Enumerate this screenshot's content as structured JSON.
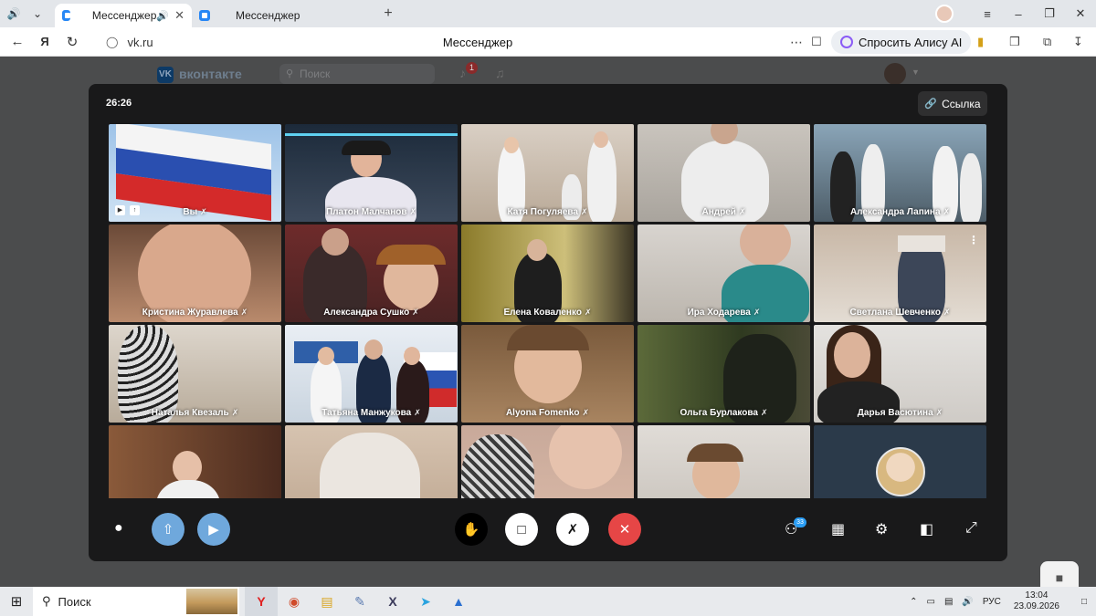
{
  "browser": {
    "tabs": [
      {
        "label": "Мессенджер",
        "active": true
      },
      {
        "label": "Мессенджер",
        "active": false
      }
    ],
    "url": "vk.ru",
    "page_title": "Мессенджер",
    "alice_label": "Спросить Алису AI"
  },
  "vk": {
    "brand": "вконтакте",
    "search_placeholder": "Поиск",
    "notifications_count": "1"
  },
  "call": {
    "timer": "26:26",
    "link_label": "Ссылка",
    "participants_count": "33",
    "participants": [
      {
        "name": "Вы"
      },
      {
        "name": "Платон Малчанов"
      },
      {
        "name": "Катя Погуляева"
      },
      {
        "name": "Андрей"
      },
      {
        "name": "Александра Лапина"
      },
      {
        "name": "Кристина Журавлева"
      },
      {
        "name": "Александра Сушко"
      },
      {
        "name": "Елена Коваленко"
      },
      {
        "name": "Ира Ходарева"
      },
      {
        "name": "Светлана Шевченко"
      },
      {
        "name": "Наталья Квезаль"
      },
      {
        "name": "Татьяна Манжукова"
      },
      {
        "name": "Alyona Fomenko"
      },
      {
        "name": "Ольга Бурлакова"
      },
      {
        "name": "Дарья Васютина"
      }
    ]
  },
  "taskbar": {
    "search_label": "Поиск",
    "lang": "РУС",
    "time": "13:04",
    "date": "23.09.2026"
  },
  "colors": {
    "call_bg": "#19191a",
    "end_call": "#e64646",
    "share_blue": "#6fa8dc",
    "accent": "#2a9df4"
  }
}
